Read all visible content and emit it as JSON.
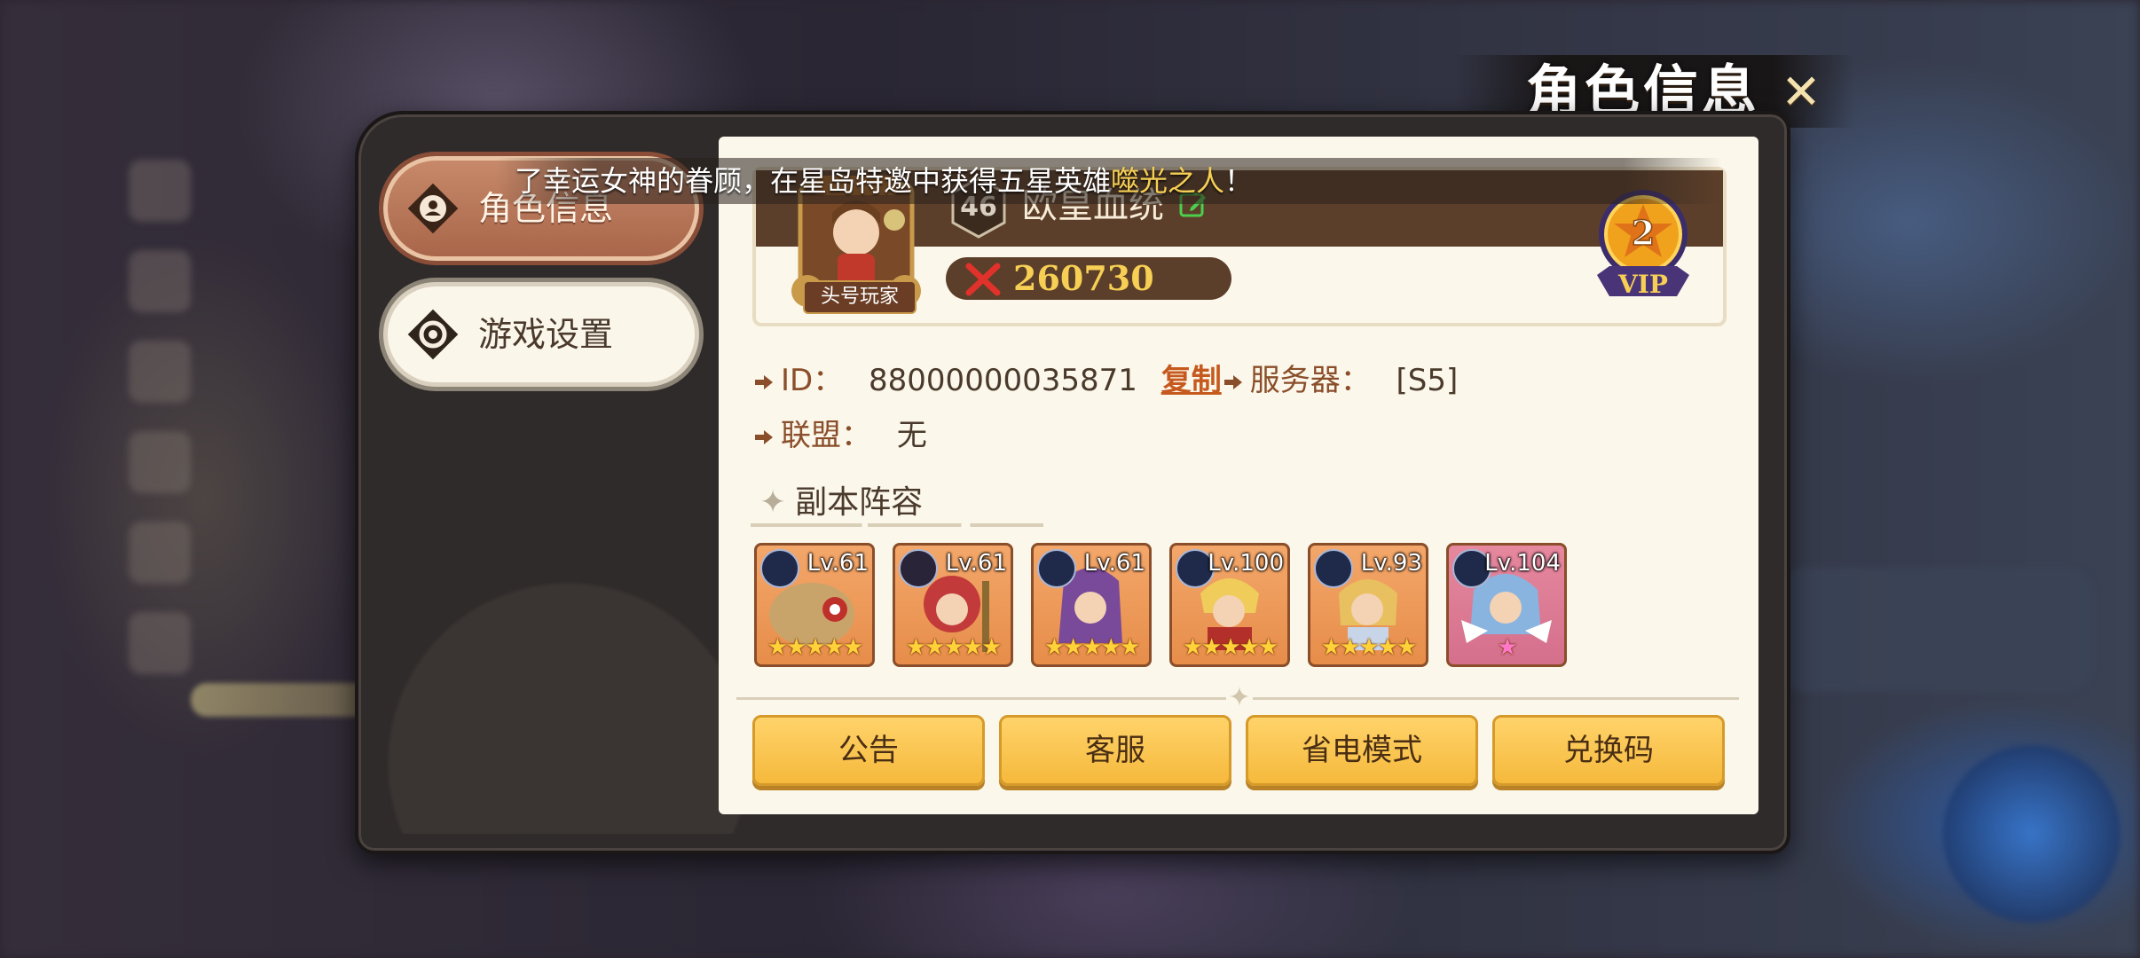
{
  "window": {
    "title": "角色信息"
  },
  "tabs": [
    {
      "label": "角色信息",
      "active": true,
      "icon": "user-icon"
    },
    {
      "label": "游戏设置",
      "active": false,
      "icon": "gear-icon"
    }
  ],
  "announcement": {
    "text": "了幸运女神的眷顾，在星岛特邀中获得五星英雄",
    "highlight": "噬光之人",
    "suffix": "！"
  },
  "profile": {
    "avatar_label": "头号玩家",
    "level": "46",
    "name": "欧皇血统",
    "power": "260730",
    "vip_level": "2",
    "vip_text": "VIP"
  },
  "info": {
    "id_label": "ID：",
    "id_value": "88000000035871",
    "copy_label": "复制",
    "server_label": "服务器：",
    "server_value": "[S5]",
    "guild_label": "联盟：",
    "guild_value": "无"
  },
  "lineup": {
    "title": "副本阵容",
    "heroes": [
      {
        "level": "Lv.61",
        "stars": "★★★★★",
        "class_icon": "shield-icon"
      },
      {
        "level": "Lv.61",
        "stars": "★★★★★",
        "class_icon": "sun-icon"
      },
      {
        "level": "Lv.61",
        "stars": "★★★★★",
        "class_icon": "shield-icon"
      },
      {
        "level": "Lv.100",
        "stars": "★★★★★",
        "class_icon": "shield-icon"
      },
      {
        "level": "Lv.93",
        "stars": "★★★★★",
        "class_icon": "shield-icon"
      },
      {
        "level": "Lv.104",
        "stars": "★",
        "class_icon": "shield-icon"
      }
    ]
  },
  "buttons": {
    "notice": "公告",
    "service": "客服",
    "power_save": "省电模式",
    "redeem": "兑换码"
  },
  "colors": {
    "accent": "#f5b93c",
    "panel": "#fbf7ea",
    "header": "#5c3f2a",
    "power": "#f6cf54"
  }
}
